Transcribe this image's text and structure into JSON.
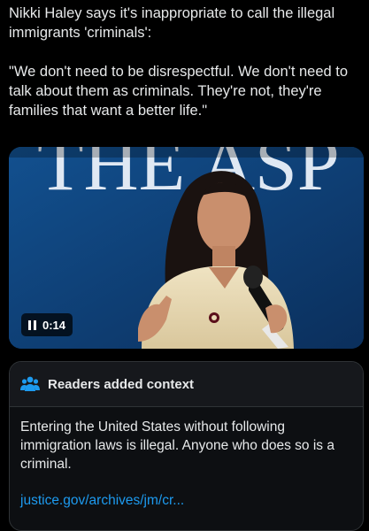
{
  "post": {
    "line1": "Nikki Haley says it's inappropriate to call the illegal immigrants 'criminals':",
    "quote": "\"We don't need to be disrespectful. We don't need to talk about them as criminals. They're not, they're families that want a better life.\""
  },
  "media": {
    "backdrop_text": "THE ASP",
    "duration": "0:14",
    "play_state_icon": "pause-icon",
    "colors": {
      "backdrop": "#0f3f7a",
      "backdrop_letters": "#dfe8f3"
    }
  },
  "context": {
    "title": "Readers added context",
    "icon": "people-icon",
    "body": "Entering the United States without following immigration laws is illegal. Anyone who does so is a criminal.",
    "link": "justice.gov/archives/jm/cr...",
    "colors": {
      "link": "#1d9bf0",
      "icon": "#1d9bf0"
    }
  }
}
